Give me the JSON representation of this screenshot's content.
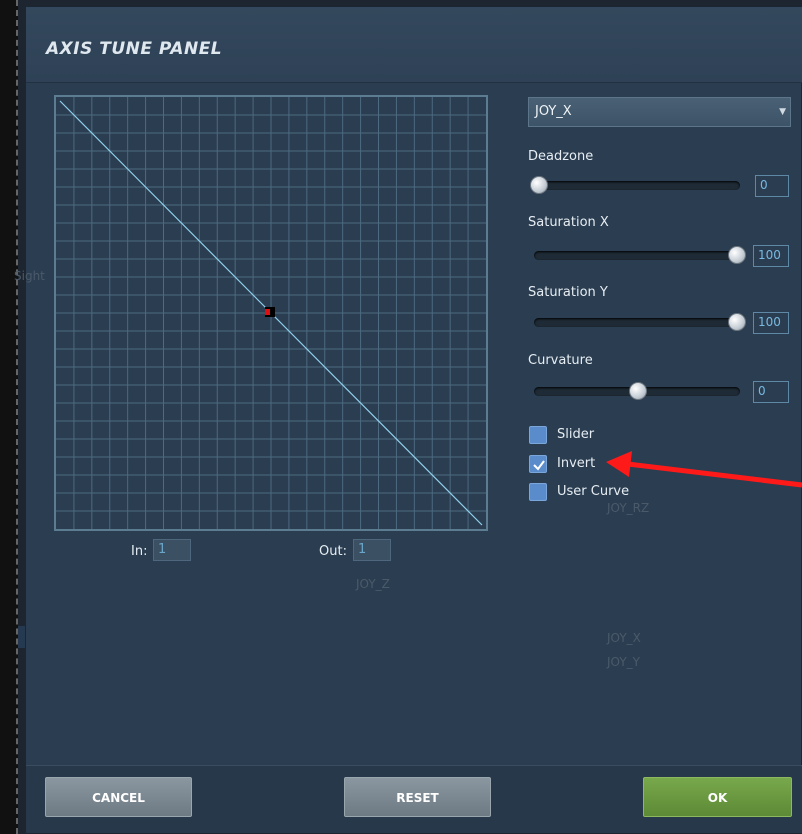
{
  "dialog": {
    "title": "AXIS TUNE PANEL"
  },
  "background": {
    "ghost_labels": [
      "Sight",
      "JOY_RZ",
      "JOY_Z",
      "JOY_X",
      "JOY_Y"
    ]
  },
  "graph": {
    "in_label": "In:",
    "in_value": "1",
    "out_label": "Out:",
    "out_value": "1"
  },
  "axis_select": {
    "selected": "JOY_X"
  },
  "controls": {
    "deadzone": {
      "label": "Deadzone",
      "value": "0",
      "level": 0
    },
    "saturation_x": {
      "label": "Saturation X",
      "value": "100",
      "level": 100
    },
    "saturation_y": {
      "label": "Saturation Y",
      "value": "100",
      "level": 100
    },
    "curvature": {
      "label": "Curvature",
      "value": "0",
      "level": 50
    }
  },
  "options": {
    "slider": {
      "label": "Slider",
      "checked": false
    },
    "invert": {
      "label": "Invert",
      "checked": true
    },
    "user_curve": {
      "label": "User Curve",
      "checked": false
    }
  },
  "buttons": {
    "cancel": "CANCEL",
    "reset": "RESET",
    "ok": "OK"
  },
  "colors": {
    "annotation_arrow": "#ff1a1a",
    "checkbox": "#5a8ccc",
    "ok_button": "#6b9a40"
  }
}
